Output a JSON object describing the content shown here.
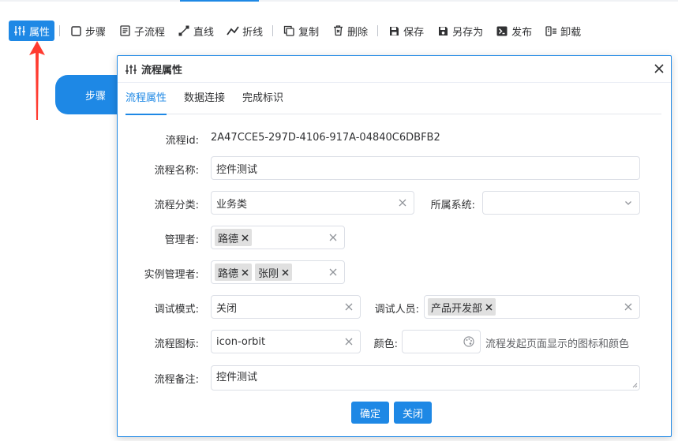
{
  "toolbar": {
    "items": [
      {
        "label": "属性",
        "icon": "sliders-icon"
      },
      {
        "label": "步骤",
        "icon": "square-icon"
      },
      {
        "label": "子流程",
        "icon": "document-icon"
      },
      {
        "label": "直线",
        "icon": "line-icon"
      },
      {
        "label": "折线",
        "icon": "polyline-icon"
      },
      {
        "label": "复制",
        "icon": "copy-icon"
      },
      {
        "label": "删除",
        "icon": "trash-icon"
      },
      {
        "label": "保存",
        "icon": "save-icon"
      },
      {
        "label": "另存为",
        "icon": "save-as-icon"
      },
      {
        "label": "发布",
        "icon": "publish-icon"
      },
      {
        "label": "卸载",
        "icon": "uninstall-icon"
      }
    ]
  },
  "canvas": {
    "step_node_label": "步骤"
  },
  "dialog": {
    "title": "流程属性",
    "tabs": [
      "流程属性",
      "数据连接",
      "完成标识"
    ],
    "form": {
      "id_label": "流程id:",
      "id_value": "2A47CCE5-297D-4106-917A-04840C6DBFB2",
      "name_label": "流程名称:",
      "name_value": "控件测试",
      "category_label": "流程分类:",
      "category_value": "业务类",
      "system_label": "所属系统:",
      "system_value": "",
      "manager_label": "管理者:",
      "manager_tags": [
        "路德"
      ],
      "instance_manager_label": "实例管理者:",
      "instance_manager_tags": [
        "路德",
        "张刚"
      ],
      "debug_mode_label": "调试模式:",
      "debug_mode_value": "关闭",
      "debug_user_label": "调试人员:",
      "debug_user_tags": [
        "产品开发部"
      ],
      "icon_label": "流程图标:",
      "icon_value": "icon-orbit",
      "color_label": "颜色:",
      "color_value": "",
      "color_hint": "流程发起页面显示的图标和颜色",
      "note_label": "流程备注:",
      "note_value": "控件测试"
    },
    "buttons": {
      "confirm": "确定",
      "close": "关闭"
    }
  },
  "colors": {
    "accent": "#1e88e5",
    "arrow": "#ff3b30"
  }
}
